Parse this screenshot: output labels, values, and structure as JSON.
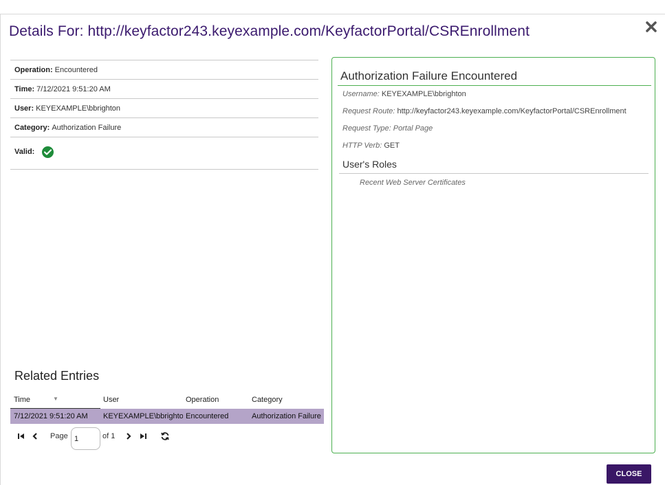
{
  "dialog": {
    "title": "Details For: http://keyfactor243.keyexample.com/KeyfactorPortal/CSREnrollment",
    "close_label": "CLOSE"
  },
  "info": {
    "operation_label": "Operation:",
    "operation_value": "Encountered",
    "time_label": "Time:",
    "time_value": "7/12/2021 9:51:20 AM",
    "user_label": "User:",
    "user_value": "KEYEXAMPLE\\bbrighton",
    "category_label": "Category:",
    "category_value": "Authorization Failure",
    "valid_label": "Valid:",
    "valid_icon": "check-circle-icon",
    "valid_color": "#1e8c3a"
  },
  "panel": {
    "title": "Authorization Failure Encountered",
    "username_label": "Username:",
    "username_value": "KEYEXAMPLE\\bbrighton",
    "route_label": "Request Route:",
    "route_value": "http://keyfactor243.keyexample.com/KeyfactorPortal/CSREnrollment",
    "type_label": "Request Type:",
    "type_value": "Portal Page",
    "verb_label": "HTTP Verb:",
    "verb_value": "GET",
    "roles_title": "User's Roles",
    "roles": [
      "Recent Web Server Certificates"
    ],
    "border_color": "#4caf50"
  },
  "related": {
    "title": "Related Entries",
    "columns": [
      "Time",
      "User",
      "Operation",
      "Category"
    ],
    "rows": [
      [
        "7/12/2021 9:51:20 AM",
        "KEYEXAMPLE\\bbrighton",
        "Encountered",
        "Authorization Failure"
      ]
    ],
    "selected_row_color": "#b4a4c8"
  },
  "pager": {
    "page_label": "Page",
    "page_value": "1",
    "of_label": "of 1"
  },
  "colors": {
    "accent": "#3a1766",
    "title": "#3b1a6e"
  }
}
